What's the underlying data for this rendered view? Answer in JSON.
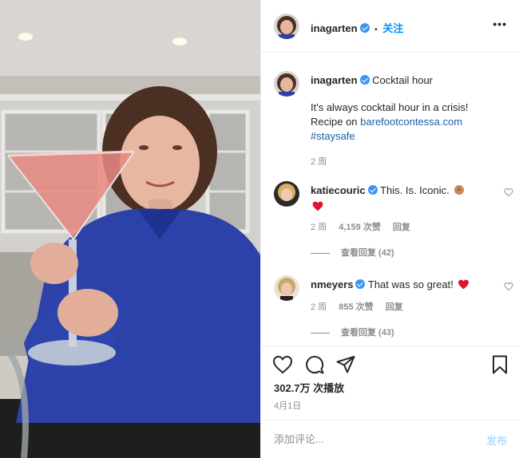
{
  "post": {
    "author": "inagarten",
    "follow_label": "关注",
    "separator": "•",
    "more_label": "•••"
  },
  "caption": {
    "username": "inagarten",
    "title": "Cocktail hour",
    "line1": "It's always cocktail hour in a crisis!",
    "recipe_prefix": "Recipe on ",
    "link": "barefootcontessa.com",
    "hashtag": "#staysafe",
    "time": "2 周"
  },
  "comments": [
    {
      "username": "katiecouric",
      "text": "This. Is. Iconic.",
      "emojis": [
        "clapping-hands",
        "red-heart"
      ],
      "time": "2 周",
      "likes": "4,159 次赞",
      "reply_label": "回复",
      "view_replies": "查看回复 (42)"
    },
    {
      "username": "nmeyers",
      "text": "That was so great!",
      "emojis": [
        "red-heart"
      ],
      "time": "2 周",
      "likes": "855 次赞",
      "reply_label": "回复",
      "view_replies": "查看回复 (43)"
    }
  ],
  "stats": {
    "views": "302.7万 次播放",
    "date": "4月1日"
  },
  "add_comment": {
    "placeholder": "添加评论...",
    "post_label": "发布"
  },
  "icons": [
    "heart-icon",
    "comment-icon",
    "share-icon",
    "bookmark-icon",
    "verified-badge-icon"
  ],
  "colors": {
    "link": "#1b5ea8",
    "follow": "#0095f6",
    "verified": "#3897f0",
    "post_disabled": "#b2dffc",
    "heart_red": "#ed4956",
    "meta_gray": "#8e8e8e"
  }
}
